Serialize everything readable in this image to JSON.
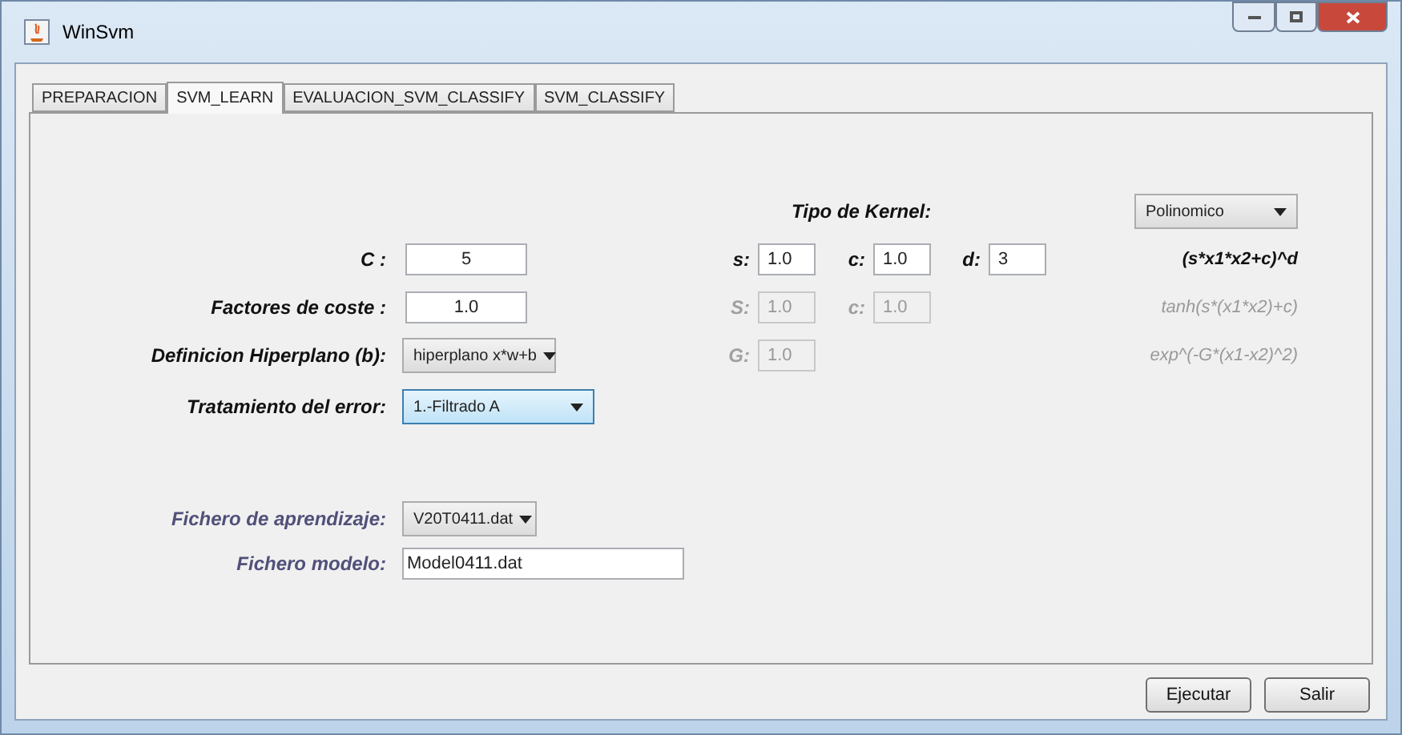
{
  "window": {
    "title": "WinSvm"
  },
  "tabs": [
    {
      "label": "PREPARACION",
      "selected": false
    },
    {
      "label": "SVM_LEARN",
      "selected": true
    },
    {
      "label": "EVALUACION_SVM_CLASSIFY",
      "selected": false
    },
    {
      "label": "SVM_CLASSIFY",
      "selected": false
    }
  ],
  "kernel": {
    "label": "Tipo de Kernel:",
    "value": "Polinomico"
  },
  "left_fields": [
    {
      "label": "C :",
      "kind": "text",
      "value": "5"
    },
    {
      "label": "Factores de coste :",
      "kind": "text",
      "value": "1.0"
    },
    {
      "label": "Definicion Hiperplano (b):",
      "kind": "dropdown",
      "value": "hiperplano x*w+b",
      "focused": false
    },
    {
      "label": "Tratamiento del error:",
      "kind": "dropdown",
      "value": "1.-Filtrado A",
      "focused": true
    }
  ],
  "kernel_rows": [
    {
      "enabled": true,
      "params": [
        {
          "label": "s:",
          "value": "1.0"
        },
        {
          "label": "c:",
          "value": "1.0"
        },
        {
          "label": "d:",
          "value": "3"
        }
      ],
      "formula": "(s*x1*x2+c)^d"
    },
    {
      "enabled": false,
      "params": [
        {
          "label": "S:",
          "value": "1.0"
        },
        {
          "label": "c:",
          "value": "1.0"
        }
      ],
      "formula": "tanh(s*(x1*x2)+c)"
    },
    {
      "enabled": false,
      "params": [
        {
          "label": "G:",
          "value": "1.0"
        }
      ],
      "formula": "exp^(-G*(x1-x2)^2)"
    }
  ],
  "files": [
    {
      "label": "Fichero de aprendizaje:",
      "kind": "dropdown",
      "value": "V20T0411.dat"
    },
    {
      "label": "Fichero modelo:",
      "kind": "text",
      "value": "Model0411.dat"
    }
  ],
  "buttons": [
    "Ejecutar",
    "Salir"
  ]
}
